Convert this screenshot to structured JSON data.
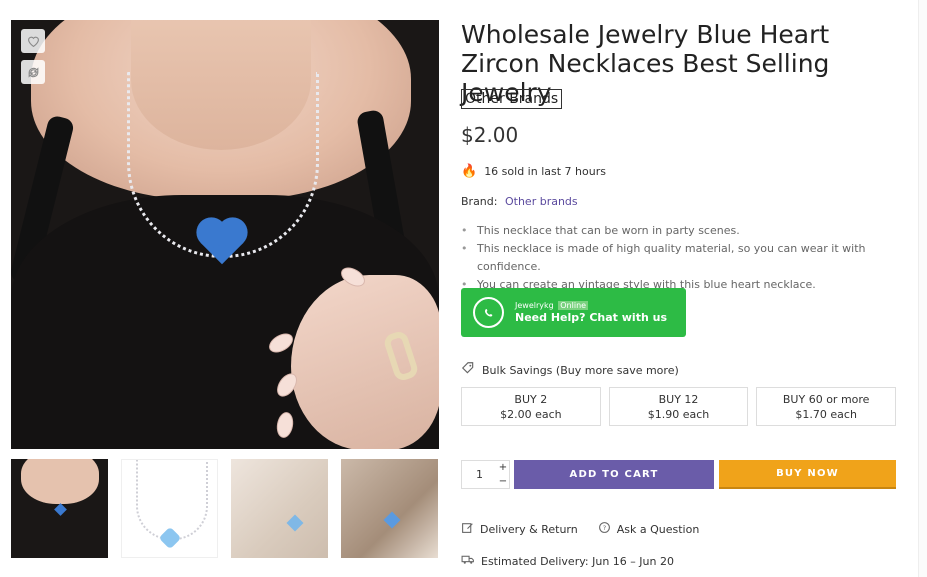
{
  "gallery": {
    "wishlist_icon": "heart-outline-icon",
    "compare_icon": "refresh-icon",
    "thumbnails": [
      "thumb-1",
      "thumb-2",
      "thumb-3",
      "thumb-4"
    ]
  },
  "product": {
    "title": "Wholesale Jewelry Blue Heart Zircon Necklaces Best Selling Jewelry",
    "brand_tag": "Other Brands",
    "price": "$2.00",
    "sold_text": "16 sold in last 7 hours",
    "brand_label": "Brand:",
    "brand_value": "Other brands",
    "features": [
      "This necklace that can be worn in party scenes.",
      "This necklace is made of high quality material, so you can wear it with confidence.",
      "You can create an vintage style with this blue heart necklace."
    ]
  },
  "whatsapp": {
    "name": "Jewelrykg",
    "status": "Online",
    "cta": "Need Help? Chat with us",
    "color": "#2dbb45"
  },
  "bulk": {
    "label": "Bulk Savings (Buy more save more)",
    "tiers": [
      {
        "qty": "BUY 2",
        "price": "$2.00 each"
      },
      {
        "qty": "BUY 12",
        "price": "$1.90 each"
      },
      {
        "qty": "BUY 60 or more",
        "price": "$1.70 each"
      }
    ]
  },
  "purchase": {
    "quantity": "1",
    "plus": "+",
    "minus": "−",
    "add_to_cart": "ADD TO CART",
    "buy_now": "BUY NOW",
    "add_color": "#6a5ca9",
    "buy_color": "#f0a31a"
  },
  "links": {
    "delivery_return": "Delivery & Return",
    "ask_question": "Ask a Question"
  },
  "delivery": {
    "estimated": "Estimated Delivery: Jun 16 – Jun 20"
  }
}
